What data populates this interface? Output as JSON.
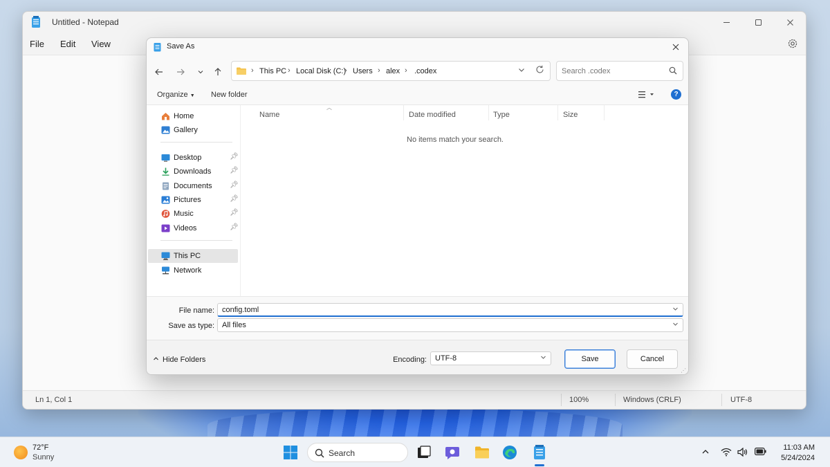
{
  "notepad": {
    "title": "Untitled - Notepad",
    "menu": [
      "File",
      "Edit",
      "View"
    ],
    "status": {
      "position": "Ln 1, Col 1",
      "zoom": "100%",
      "line_ending": "Windows (CRLF)",
      "encoding": "UTF-8"
    }
  },
  "dialog": {
    "title": "Save As",
    "breadcrumb": [
      "This PC",
      "Local Disk (C:)",
      "Users",
      "alex",
      ".codex"
    ],
    "search_placeholder": "Search .codex",
    "commands": {
      "organize": "Organize",
      "new_folder": "New folder"
    },
    "nav_pane": {
      "group1": [
        {
          "label": "Home",
          "icon": "home-icon"
        },
        {
          "label": "Gallery",
          "icon": "gallery-icon"
        }
      ],
      "pinned": [
        {
          "label": "Desktop",
          "icon": "desktop-icon"
        },
        {
          "label": "Downloads",
          "icon": "downloads-icon"
        },
        {
          "label": "Documents",
          "icon": "documents-icon"
        },
        {
          "label": "Pictures",
          "icon": "pictures-icon"
        },
        {
          "label": "Music",
          "icon": "music-icon"
        },
        {
          "label": "Videos",
          "icon": "videos-icon"
        }
      ],
      "group3": [
        {
          "label": "This PC",
          "icon": "this-pc-icon",
          "selected": true
        },
        {
          "label": "Network",
          "icon": "network-icon"
        }
      ]
    },
    "columns": [
      "Name",
      "Date modified",
      "Type",
      "Size"
    ],
    "empty_message": "No items match your search.",
    "file_name_label": "File name:",
    "file_name_value": "config.toml",
    "save_type_label": "Save as type:",
    "save_type_value": "All files",
    "hide_folders": "Hide Folders",
    "encoding_label": "Encoding:",
    "encoding_value": "UTF-8",
    "save_button": "Save",
    "cancel_button": "Cancel"
  },
  "taskbar": {
    "weather": {
      "temp": "72°F",
      "condition": "Sunny"
    },
    "search_label": "Search",
    "clock": {
      "time": "11:03 AM",
      "date": "5/24/2024"
    }
  },
  "colors": {
    "accent": "#1f6fd1",
    "selection": "#e5e5e5"
  }
}
